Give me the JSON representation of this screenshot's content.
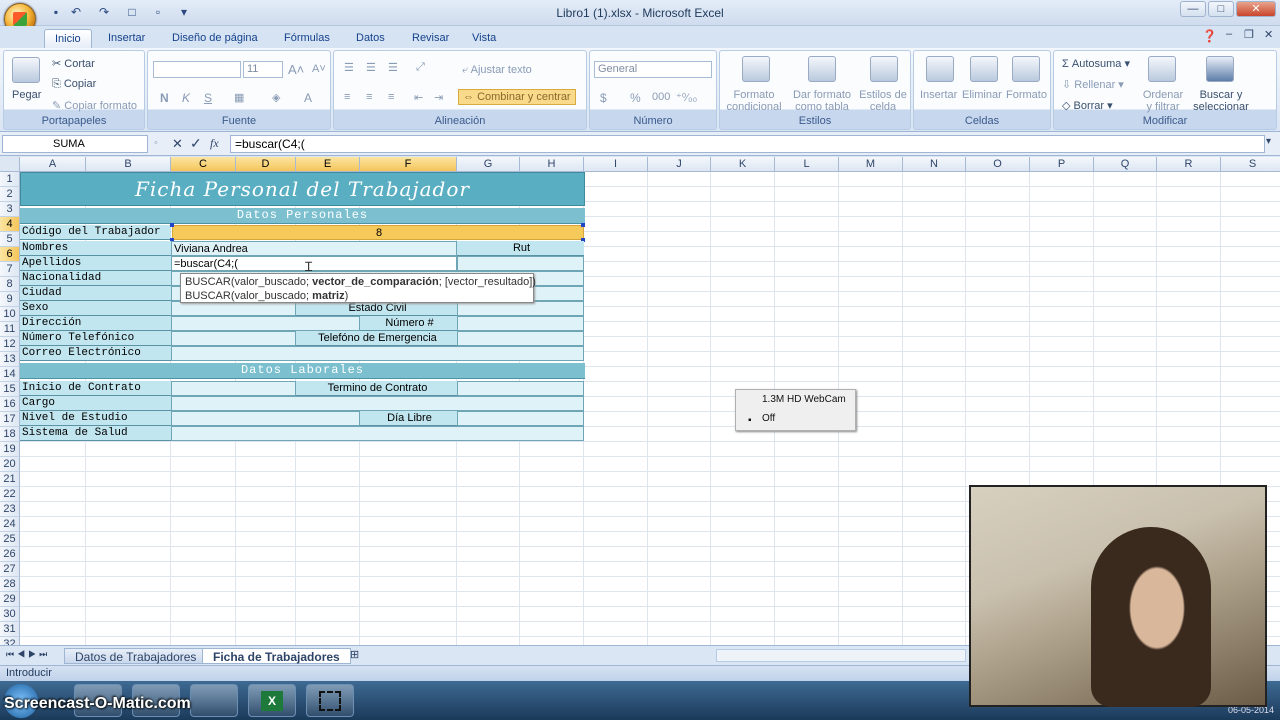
{
  "window": {
    "title": "Libro1 (1).xlsx - Microsoft Excel",
    "min": "—",
    "max": "□",
    "close": "✕"
  },
  "ribbon_tabs": [
    "Inicio",
    "Insertar",
    "Diseño de página",
    "Fórmulas",
    "Datos",
    "Revisar",
    "Vista"
  ],
  "clipboard": {
    "paste": "Pegar",
    "cut": "Cortar",
    "copy": "Copiar",
    "format_painter": "Copiar formato",
    "label": "Portapapeles"
  },
  "font": {
    "size": "11",
    "bold": "N",
    "italic": "K",
    "underline": "S",
    "label": "Fuente"
  },
  "alignment": {
    "wrap": "Ajustar texto",
    "merge": "Combinar y centrar",
    "label": "Alineación"
  },
  "number": {
    "format": "General",
    "currency": "$",
    "percent": "%",
    "thousands": "000",
    "label": "Número"
  },
  "styles": {
    "conditional_l1": "Formato",
    "conditional_l2": "condicional",
    "table_l1": "Dar formato",
    "table_l2": "como tabla",
    "cell_l1": "Estilos de",
    "cell_l2": "celda",
    "label": "Estilos"
  },
  "cells": {
    "insert": "Insertar",
    "delete": "Eliminar",
    "format": "Formato",
    "label": "Celdas"
  },
  "editing": {
    "autosum": "Autosuma",
    "fill": "Rellenar",
    "clear": "Borrar",
    "sort_l1": "Ordenar",
    "sort_l2": "y filtrar",
    "find_l1": "Buscar y",
    "find_l2": "seleccionar",
    "label": "Modificar"
  },
  "formula_bar": {
    "name_box": "SUMA",
    "cancel": "✕",
    "enter": "✓",
    "fx": "fx",
    "formula": "=buscar(C4;("
  },
  "columns": [
    "A",
    "B",
    "C",
    "D",
    "E",
    "F",
    "G",
    "H",
    "I",
    "J",
    "K",
    "L",
    "M",
    "N",
    "O",
    "P",
    "Q",
    "R",
    "S"
  ],
  "rows": [
    "1",
    "2",
    "3",
    "4",
    "5",
    "6",
    "7",
    "8",
    "9",
    "10",
    "11",
    "12",
    "13",
    "14",
    "15",
    "16",
    "17",
    "18",
    "19",
    "20",
    "21",
    "22",
    "23",
    "24",
    "25",
    "26",
    "27",
    "28",
    "29",
    "30",
    "31",
    "32"
  ],
  "sheet": {
    "title": "Ficha Personal del Trabajador",
    "section_personal": "Datos Personales",
    "section_work": "Datos Laborales",
    "labels": {
      "codigo": "Código del Trabajador",
      "nombres": "Nombres",
      "apellidos": "Apellidos",
      "nacionalidad": "Nacionalidad",
      "ciudad": "Ciudad",
      "sexo": "Sexo",
      "direccion": "Dirección",
      "telefono": "Número Telefónico",
      "correo": "Correo Electrónico",
      "inicio": "Inicio de Contrato",
      "cargo": "Cargo",
      "estudio": "Nivel de Estudio",
      "salud": "Sistema de Salud"
    },
    "right_labels": {
      "rut": "Rut",
      "estado_civil": "Estado Civil",
      "numero": "Número #",
      "emergencia": "Telefóno de Emergencia",
      "termino": "Termino de Contrato",
      "dia_libre": "Día Libre"
    },
    "values": {
      "codigo": "8",
      "nombres": "Viviana Andrea",
      "apellidos_edit": "=buscar(C4;("
    }
  },
  "tooltip": {
    "line1_prefix": "BUSCAR(valor_buscado; ",
    "line1_bold": "vector_de_comparación",
    "line1_suffix": "; [vector_resultado])",
    "line2_prefix": "BUSCAR(valor_buscado; ",
    "line2_bold": "matriz",
    "line2_suffix": ")"
  },
  "sheet_tabs": [
    "Datos de Trabajadores",
    "Ficha de Trabajadores"
  ],
  "status": "Introducir",
  "webcam_popup": {
    "title": "1.3M HD WebCam",
    "state": "Off"
  },
  "watermark": "Screencast-O-Matic.com",
  "date": "06-05-2014",
  "colors": {
    "accent": "#5aaec2",
    "header_fill": "#c2e6ef",
    "selected": "#f6c95b"
  }
}
